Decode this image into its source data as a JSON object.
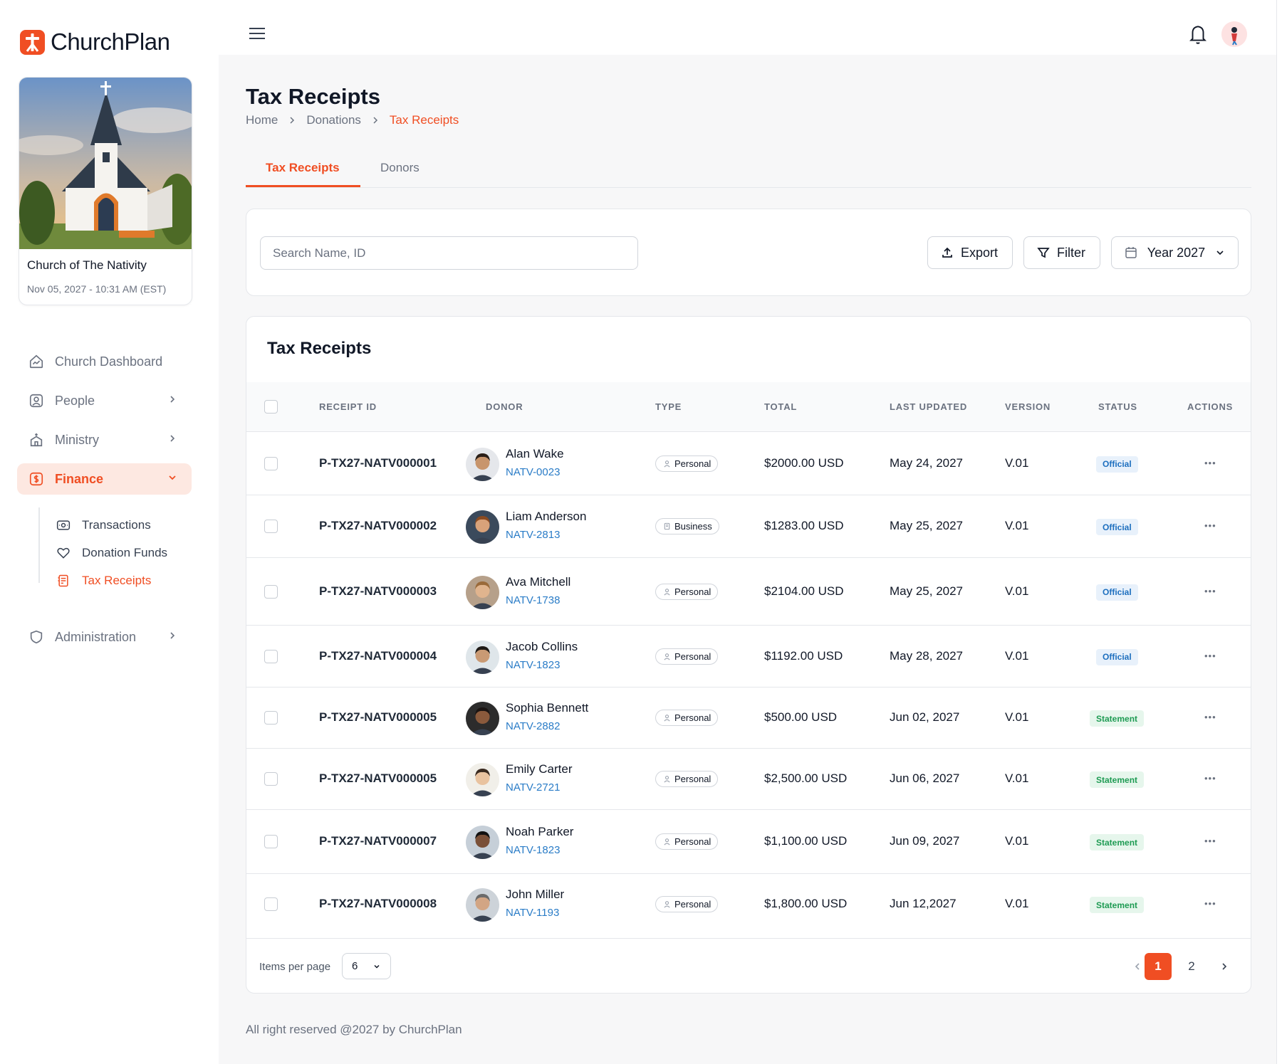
{
  "brand": {
    "name": "ChurchPlan",
    "accent": "#f04e23"
  },
  "church": {
    "name": "Church of The Nativity",
    "datetime": "Nov 05, 2027 - 10:31 AM (EST)"
  },
  "nav": {
    "items": [
      {
        "label": "Church Dashboard",
        "icon": "dashboard-icon"
      },
      {
        "label": "People",
        "icon": "user-icon"
      },
      {
        "label": "Ministry",
        "icon": "church-icon"
      },
      {
        "label": "Finance",
        "icon": "dollar-icon"
      },
      {
        "label": "Administration",
        "icon": "shield-icon"
      }
    ],
    "finance_sub": [
      {
        "label": "Transactions",
        "icon": "money-icon"
      },
      {
        "label": "Donation Funds",
        "icon": "heart-icon"
      },
      {
        "label": "Tax Receipts",
        "icon": "receipt-icon"
      }
    ]
  },
  "page": {
    "title": "Tax Receipts",
    "breadcrumb": [
      "Home",
      "Donations",
      "Tax Receipts"
    ]
  },
  "tabs": [
    "Tax Receipts",
    "Donors"
  ],
  "filters": {
    "search_placeholder": "Search Name, ID",
    "export_label": "Export",
    "filter_label": "Filter",
    "year_label": "Year 2027"
  },
  "table": {
    "title": "Tax Receipts",
    "columns": [
      "RECEIPT ID",
      "DONOR",
      "TYPE",
      "TOTAL",
      "LAST UPDATED",
      "VERSION",
      "STATUS",
      "ACTIONS"
    ],
    "rows": [
      {
        "id": "P-TX27-NATV000001",
        "donor": "Alan Wake",
        "donor_id": "NATV-0023",
        "type": "Personal",
        "total": "$2000.00 USD",
        "updated": "May 24, 2027",
        "version": "V.01",
        "status": "Official"
      },
      {
        "id": "P-TX27-NATV000002",
        "donor": "Liam Anderson",
        "donor_id": "NATV-2813",
        "type": "Business",
        "total": "$1283.00 USD",
        "updated": "May 25, 2027",
        "version": "V.01",
        "status": "Official"
      },
      {
        "id": "P-TX27-NATV000003",
        "donor": "Ava Mitchell",
        "donor_id": "NATV-1738",
        "type": "Personal",
        "total": "$2104.00 USD",
        "updated": "May 25, 2027",
        "version": "V.01",
        "status": "Official"
      },
      {
        "id": "P-TX27-NATV000004",
        "donor": "Jacob Collins",
        "donor_id": "NATV-1823",
        "type": "Personal",
        "total": "$1192.00 USD",
        "updated": "May 28, 2027",
        "version": "V.01",
        "status": "Official"
      },
      {
        "id": "P-TX27-NATV000005",
        "donor": "Sophia Bennett",
        "donor_id": "NATV-2882",
        "type": "Personal",
        "total": "$500.00 USD",
        "updated": "Jun 02, 2027",
        "version": "V.01",
        "status": "Statement"
      },
      {
        "id": "P-TX27-NATV000005",
        "donor": "Emily Carter",
        "donor_id": "NATV-2721",
        "type": "Personal",
        "total": "$2,500.00 USD",
        "updated": "Jun 06, 2027",
        "version": "V.01",
        "status": "Statement"
      },
      {
        "id": "P-TX27-NATV000007",
        "donor": "Noah Parker",
        "donor_id": "NATV-1823",
        "type": "Personal",
        "total": "$1,100.00 USD",
        "updated": "Jun 09, 2027",
        "version": "V.01",
        "status": "Statement"
      },
      {
        "id": "P-TX27-NATV000008",
        "donor": "John Miller",
        "donor_id": "NATV-1193",
        "type": "Personal",
        "total": "$1,800.00 USD",
        "updated": "Jun 12,2027",
        "version": "V.01",
        "status": "Statement"
      }
    ]
  },
  "pagination": {
    "items_per_page_label": "Items per page",
    "items_per_page": "6",
    "pages": [
      "1",
      "2"
    ],
    "current": "1"
  },
  "footer": "All right reserved @2027 by ChurchPlan"
}
